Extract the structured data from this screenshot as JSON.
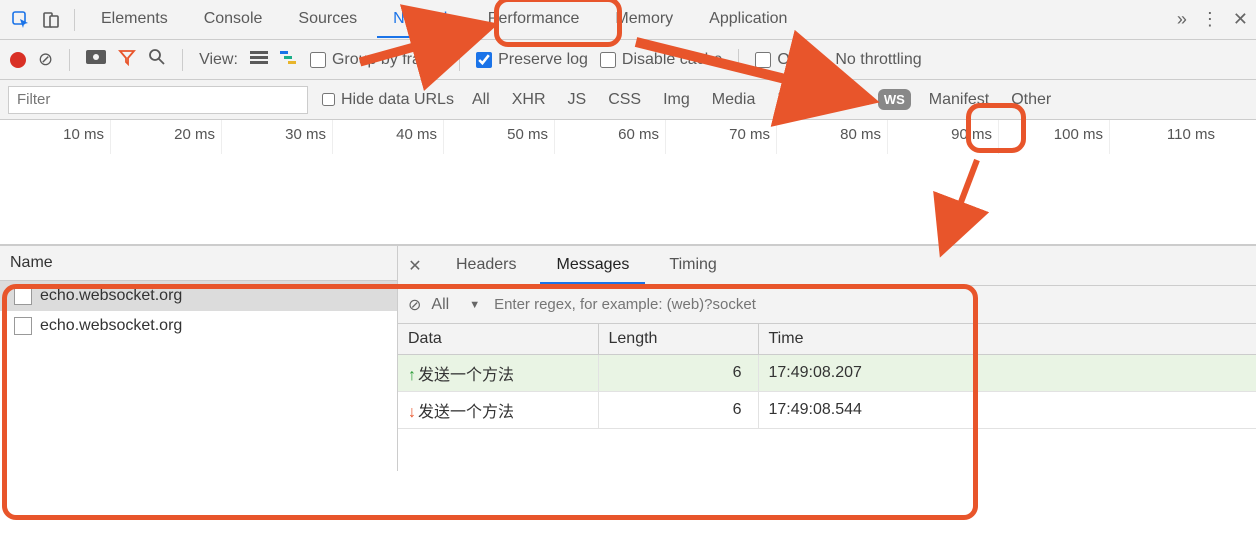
{
  "tabs": {
    "elements": "Elements",
    "console": "Console",
    "sources": "Sources",
    "network": "Network",
    "performance": "Performance",
    "memory": "Memory",
    "application": "Application"
  },
  "toolbar": {
    "view": "View:",
    "group_by_frame": "Group by frame",
    "preserve_log": "Preserve log",
    "disable_cache": "Disable cache",
    "offline": "Offline",
    "no_throttling": "No throttling"
  },
  "filter": {
    "placeholder": "Filter",
    "hide_data_urls": "Hide data URLs",
    "types": [
      "All",
      "XHR",
      "JS",
      "CSS",
      "Img",
      "Media",
      "Font",
      "Doc",
      "WS",
      "Manifest",
      "Other"
    ]
  },
  "timeline": {
    "ticks": [
      "10 ms",
      "20 ms",
      "30 ms",
      "40 ms",
      "50 ms",
      "60 ms",
      "70 ms",
      "80 ms",
      "90 ms",
      "100 ms",
      "110 ms"
    ]
  },
  "connections": {
    "header": "Name",
    "items": [
      "echo.websocket.org",
      "echo.websocket.org"
    ]
  },
  "detail": {
    "tabs": {
      "headers": "Headers",
      "messages": "Messages",
      "timing": "Timing"
    },
    "filter_all": "All",
    "regex_placeholder": "Enter regex, for example: (web)?socket",
    "columns": [
      "Data",
      "Length",
      "Time"
    ],
    "rows": [
      {
        "dir": "up",
        "data": "发送一个方法",
        "length": "6",
        "time": "17:49:08.207"
      },
      {
        "dir": "down",
        "data": "发送一个方法",
        "length": "6",
        "time": "17:49:08.544"
      }
    ]
  }
}
